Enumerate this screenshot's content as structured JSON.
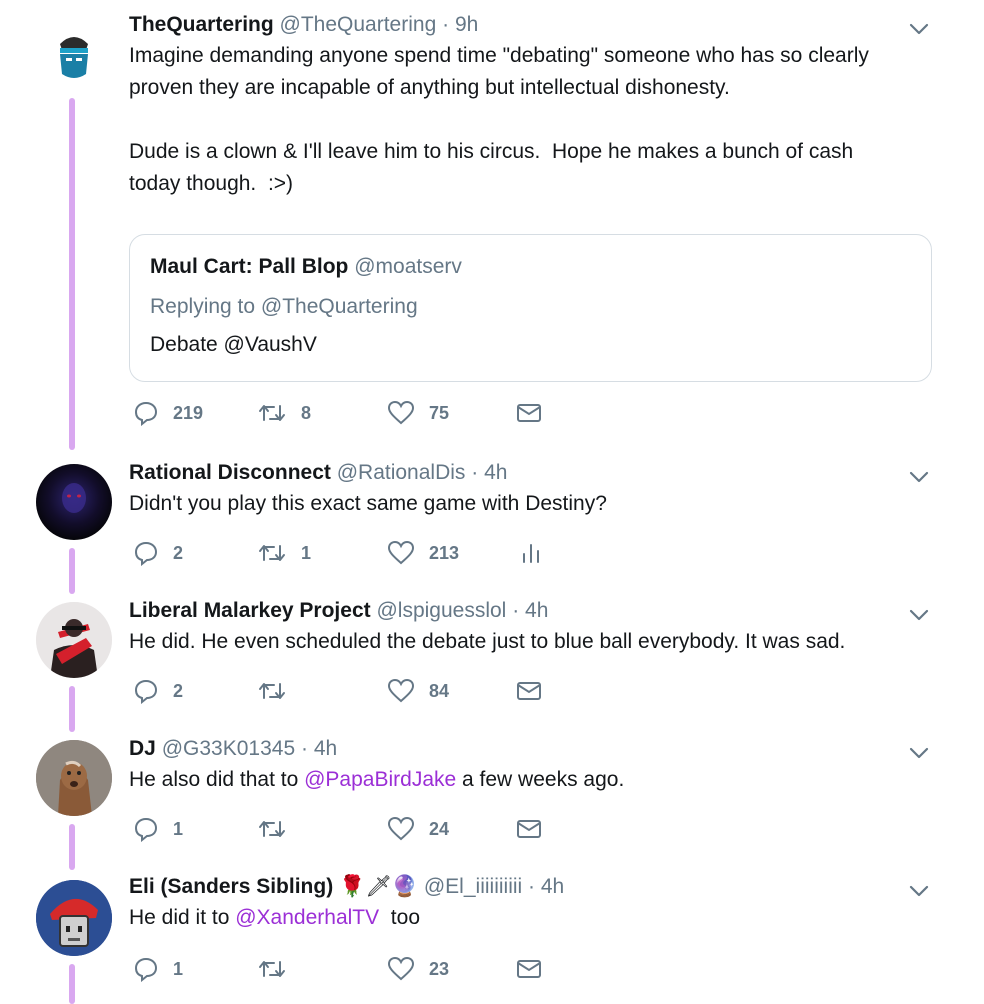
{
  "tweets": [
    {
      "name": "TheQuartering",
      "handle": "@TheQuartering",
      "time": "9h",
      "text": "Imagine demanding anyone spend time \"debating\" someone who has so clearly\nproven they are incapable of anything but intellectual dishonesty.\n\nDude is a clown & I'll leave him to his circus.  Hope he makes a bunch of cash\ntoday though.  :>)",
      "quote": {
        "name": "Maul Cart: Pall Blop",
        "handle": "@moatserv",
        "replying": "Replying to @TheQuartering",
        "text": "Debate @VaushV"
      },
      "replies": "219",
      "retweets": "8",
      "likes": "75"
    },
    {
      "name": "Rational Disconnect",
      "handle": "@RationalDis",
      "time": "4h",
      "text": "Didn't you play this exact same game with Destiny?",
      "replies": "2",
      "retweets": "1",
      "likes": "213"
    },
    {
      "name": "Liberal Malarkey Project",
      "handle": "@lspiguesslol",
      "time": "4h",
      "text": "He did. He even scheduled the debate just to blue ball everybody. It was sad.",
      "replies": "2",
      "retweets": "",
      "likes": "84"
    },
    {
      "name": "DJ",
      "handle": "@G33K01345",
      "time": "4h",
      "text_before": "He also did that to ",
      "mention": "@PapaBirdJake",
      "text_after": " a few weeks ago.",
      "replies": "1",
      "retweets": "",
      "likes": "24"
    },
    {
      "name": "Eli (Sanders Sibling)",
      "emojis": "🌹🗡🔮",
      "handle": "@El_iiiiiiiiii",
      "time": "4h",
      "text_before": "He did it to ",
      "mention": "@XanderhalTV",
      "text_after": "  too",
      "replies": "1",
      "retweets": "",
      "likes": "23"
    }
  ],
  "icons": {
    "reply": "reply-icon",
    "retweet": "retweet-icon",
    "like": "heart-icon",
    "dm": "envelope-icon",
    "analytics": "analytics-icon",
    "more": "chevron-down-icon"
  },
  "colors": {
    "thread_line": "#d9a8f0",
    "mention": "#9b2fd6",
    "secondary": "#657786"
  }
}
